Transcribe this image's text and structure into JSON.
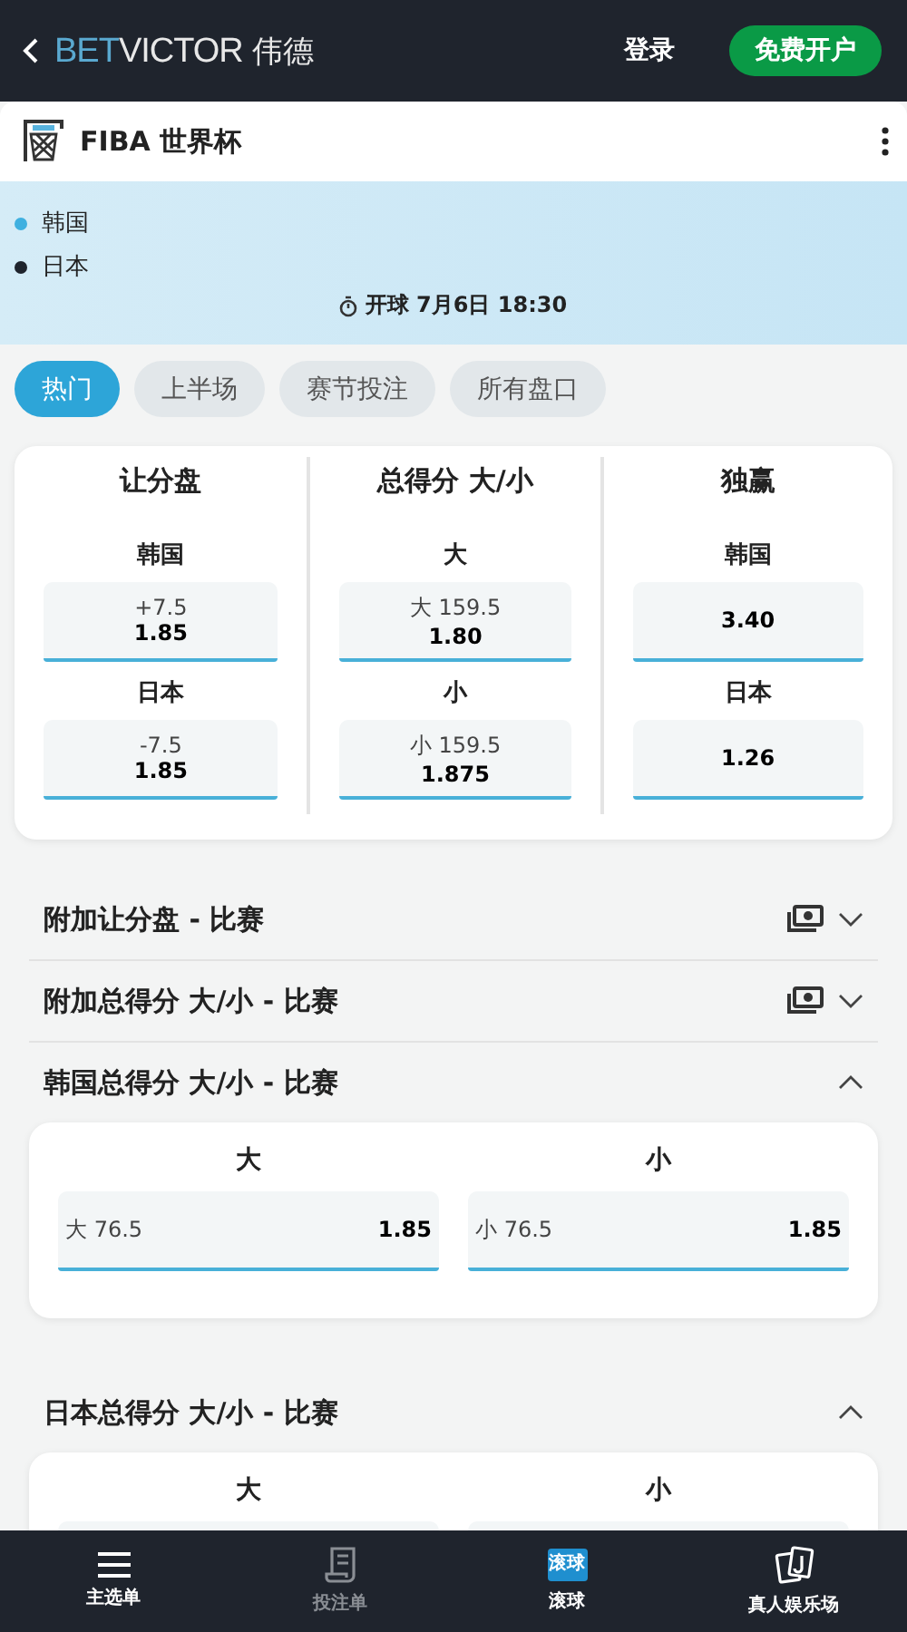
{
  "header": {
    "logo": {
      "part_1": "BET",
      "part_2": "VICTOR",
      "part_3": "伟德"
    },
    "login": "登录",
    "signup": "免费开户"
  },
  "competition": {
    "title": "FIBA 世界杯"
  },
  "match": {
    "teams": [
      {
        "name": "韩国",
        "color": "#3fb0e0"
      },
      {
        "name": "日本",
        "color": "#1f242d"
      }
    ],
    "kickoff": "开球 7月6日 18:30"
  },
  "tabs": [
    {
      "label": "热门",
      "selected": true
    },
    {
      "label": "上半场",
      "selected": false
    },
    {
      "label": "赛节投注",
      "selected": false
    },
    {
      "label": "所有盘口",
      "selected": false
    }
  ],
  "main_markets": [
    {
      "title": "让分盘",
      "selections": [
        {
          "label": "韩国",
          "line": "+7.5",
          "odds": "1.85"
        },
        {
          "label": "日本",
          "line": "-7.5",
          "odds": "1.85"
        }
      ]
    },
    {
      "title": "总得分 大/小",
      "selections": [
        {
          "label": "大",
          "line": "大 159.5",
          "odds": "1.80"
        },
        {
          "label": "小",
          "line": "小 159.5",
          "odds": "1.875"
        }
      ]
    },
    {
      "title": "独赢",
      "selections": [
        {
          "label": "韩国",
          "odds": "3.40"
        },
        {
          "label": "日本",
          "odds": "1.26"
        }
      ]
    }
  ],
  "sections": [
    {
      "title": "附加让分盘 - 比赛",
      "expanded": false,
      "boost": true
    },
    {
      "title": "附加总得分 大/小 - 比赛",
      "expanded": false,
      "boost": true
    },
    {
      "title": "韩国总得分 大/小 - 比赛",
      "expanded": true,
      "boost": false,
      "columns": [
        {
          "heading": "大",
          "line": "大 76.5",
          "odds": "1.85"
        },
        {
          "heading": "小",
          "line": "小 76.5",
          "odds": "1.85"
        }
      ]
    },
    {
      "title": "日本总得分 大/小 - 比赛",
      "expanded": true,
      "boost": false,
      "columns": [
        {
          "heading": "大"
        },
        {
          "heading": "小"
        }
      ]
    }
  ],
  "nav": [
    {
      "kind": "menu",
      "label": "主选单",
      "disabled": false
    },
    {
      "kind": "betslip",
      "label": "投注单",
      "disabled": true
    },
    {
      "kind": "live",
      "label": "滚球",
      "icon_text": "滚球",
      "disabled": false
    },
    {
      "kind": "casino",
      "label": "真人娱乐场",
      "disabled": false
    }
  ]
}
